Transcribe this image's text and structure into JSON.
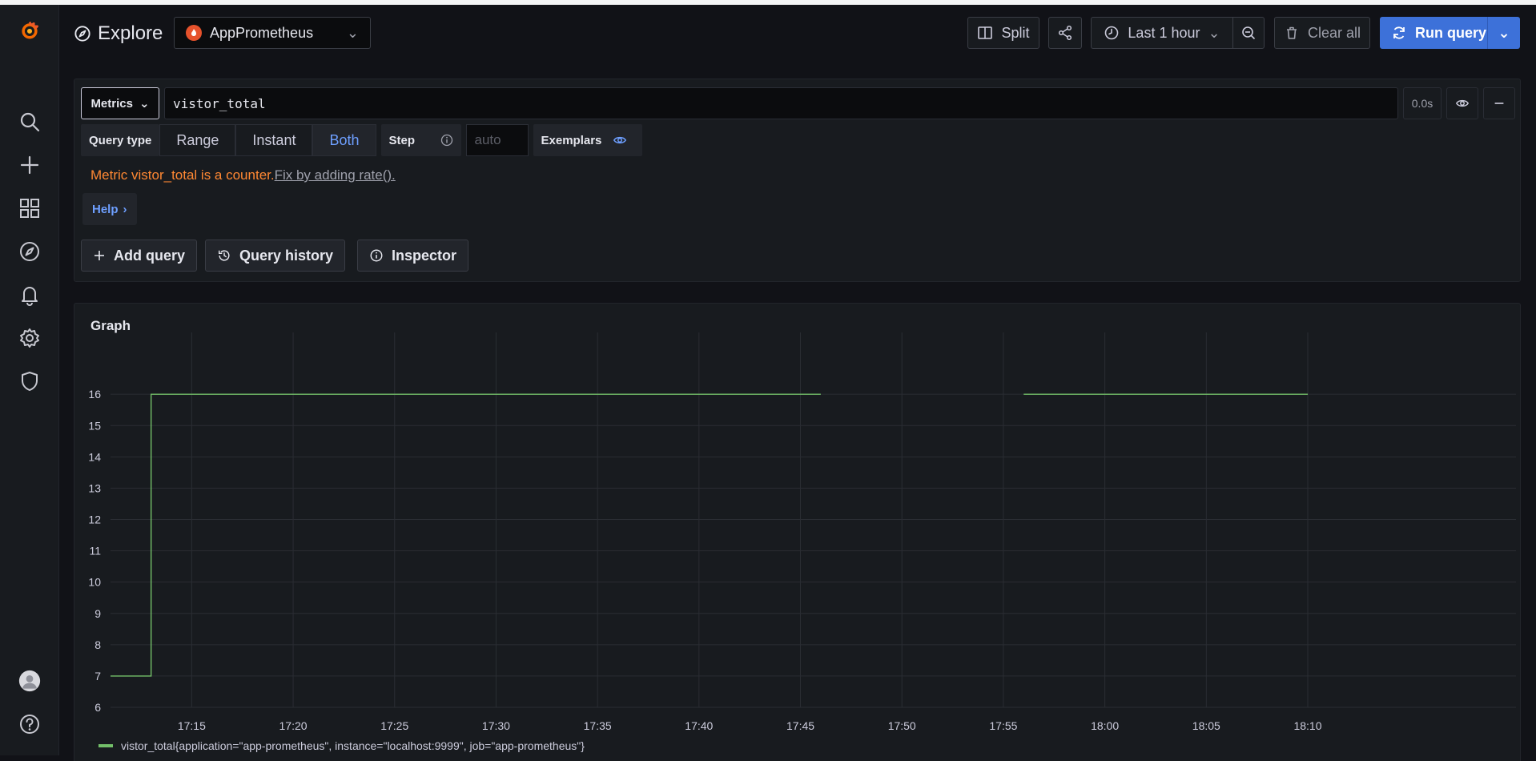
{
  "header": {
    "title": "Explore",
    "datasource": "AppPrometheus",
    "split_label": "Split",
    "time_range_label": "Last 1 hour",
    "clear_all_label": "Clear all",
    "run_query_label": "Run query"
  },
  "query": {
    "metrics_label": "Metrics",
    "expression": "vistor_total",
    "duration": "0.0s",
    "query_type_label": "Query type",
    "query_types": [
      "Range",
      "Instant",
      "Both"
    ],
    "selected_query_type": "Both",
    "step_label": "Step",
    "step_placeholder": "auto",
    "exemplars_label": "Exemplars",
    "warning_text": "Metric vistor_total is a counter.",
    "warning_link": "Fix by adding rate().",
    "help_label": "Help",
    "add_query_label": "Add query",
    "query_history_label": "Query history",
    "inspector_label": "Inspector"
  },
  "graph": {
    "title": "Graph",
    "legend_label": "vistor_total{application=\"app-prometheus\", instance=\"localhost:9999\", job=\"app-prometheus\"}",
    "series_color": "#73bf69"
  },
  "chart_data": {
    "type": "line",
    "x_ticks": [
      "17:15",
      "17:20",
      "17:25",
      "17:30",
      "17:35",
      "17:40",
      "17:45",
      "17:50",
      "17:55",
      "18:00",
      "18:05",
      "18:10"
    ],
    "y_ticks": [
      6,
      7,
      8,
      9,
      10,
      11,
      12,
      13,
      14,
      15,
      16
    ],
    "ylim": [
      6,
      16.9
    ],
    "x_range_minutes": [
      "17:11",
      "18:10"
    ],
    "series": [
      {
        "segments": [
          {
            "points": [
              [
                "17:11",
                7
              ],
              [
                "17:13",
                7
              ],
              [
                "17:13",
                16
              ],
              [
                "17:46",
                16
              ]
            ]
          },
          {
            "points": [
              [
                "17:56",
                16
              ],
              [
                "18:10",
                16
              ]
            ]
          }
        ]
      }
    ],
    "grid": true
  },
  "colors": {
    "accent": "#3d71d9",
    "warning": "#ff8833",
    "link": "#6e9fff",
    "series": "#73bf69"
  }
}
